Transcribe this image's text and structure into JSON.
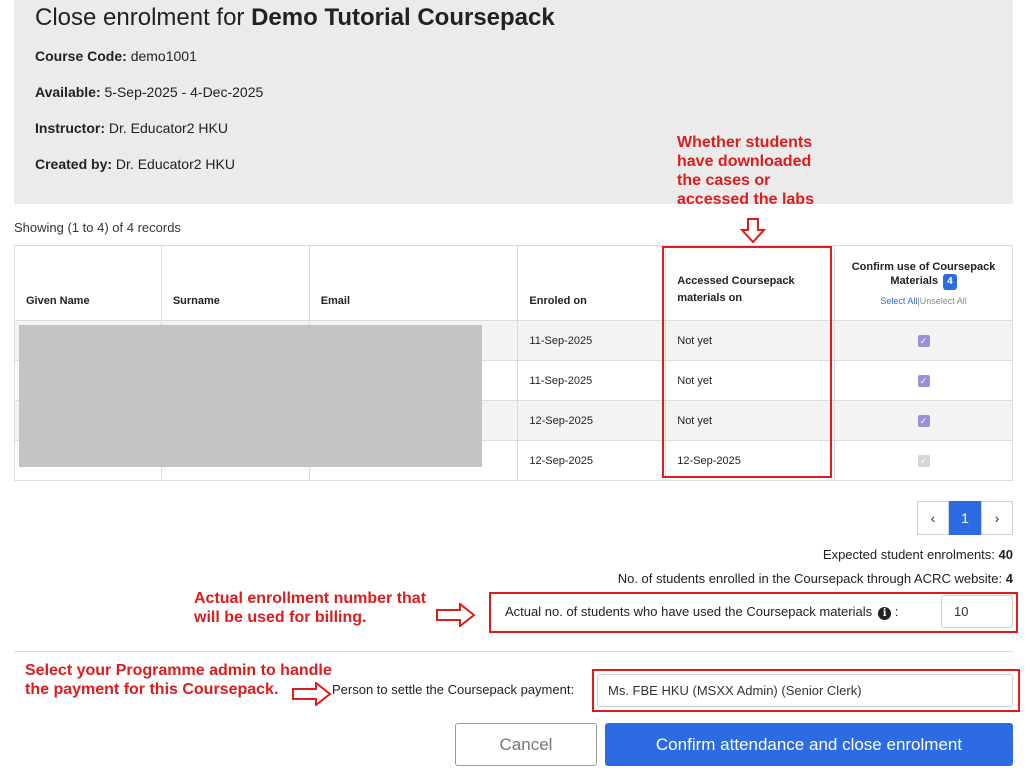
{
  "header": {
    "title_prefix": "Close enrolment for ",
    "title_course": "Demo Tutorial Coursepack",
    "course_code_label": "Course Code:",
    "course_code": "demo1001",
    "available_label": "Available:",
    "available": "5-Sep-2025 - 4-Dec-2025",
    "instructor_label": "Instructor:",
    "instructor": "Dr. Educator2 HKU",
    "created_label": "Created by:",
    "created_by": "Dr. Educator2 HKU"
  },
  "annotations": {
    "accessed": "Whether students have downloaded the cases or accessed the labs",
    "billing": "Actual enrollment number that will be used for billing.",
    "admin": "Select your Programme admin to handle the payment for this Coursepack."
  },
  "table": {
    "showing": "Showing (1 to 4) of 4 records",
    "headers": {
      "given_name": "Given Name",
      "surname": "Surname",
      "email": "Email",
      "enroled_on": "Enroled on",
      "accessed": "Accessed Coursepack materials on",
      "confirm": "Confirm use of Coursepack Materials",
      "confirm_count": "4",
      "select_all": "Select All",
      "separator": "|",
      "unselect_all": "Unselect All"
    },
    "rows": [
      {
        "enroled_on": "11-Sep-2025",
        "accessed": "Not yet",
        "checked": true
      },
      {
        "enroled_on": "11-Sep-2025",
        "accessed": "Not yet",
        "checked": true
      },
      {
        "enroled_on": "12-Sep-2025",
        "accessed": "Not yet",
        "checked": true
      },
      {
        "enroled_on": "12-Sep-2025",
        "accessed": "12-Sep-2025",
        "checked": true
      }
    ]
  },
  "pagination": {
    "prev": "‹",
    "current": "1",
    "next": "›"
  },
  "summary": {
    "expected_label": "Expected student enrolments:",
    "expected": "40",
    "enrolled_label": "No. of students enrolled in the Coursepack through ACRC website:",
    "enrolled": "4",
    "used_label": "Actual no. of students who have used the Coursepack materials",
    "used_colon": ":",
    "used_value": "10"
  },
  "payment": {
    "label": "Person to settle the Coursepack payment:",
    "selected": "Ms. FBE  HKU (MSXX Admin) (Senior Clerk)"
  },
  "actions": {
    "cancel": "Cancel",
    "confirm": "Confirm attendance and close enrolment"
  },
  "colors": {
    "accent": "#2d6be5",
    "annotation": "#e01b1b",
    "header_bg": "#ebebeb"
  },
  "icons": {
    "info": "info-icon",
    "arrow_down": "outline-arrow-down-icon",
    "arrow_right": "outline-arrow-right-icon",
    "checkbox": "checkbox-checked-icon"
  }
}
